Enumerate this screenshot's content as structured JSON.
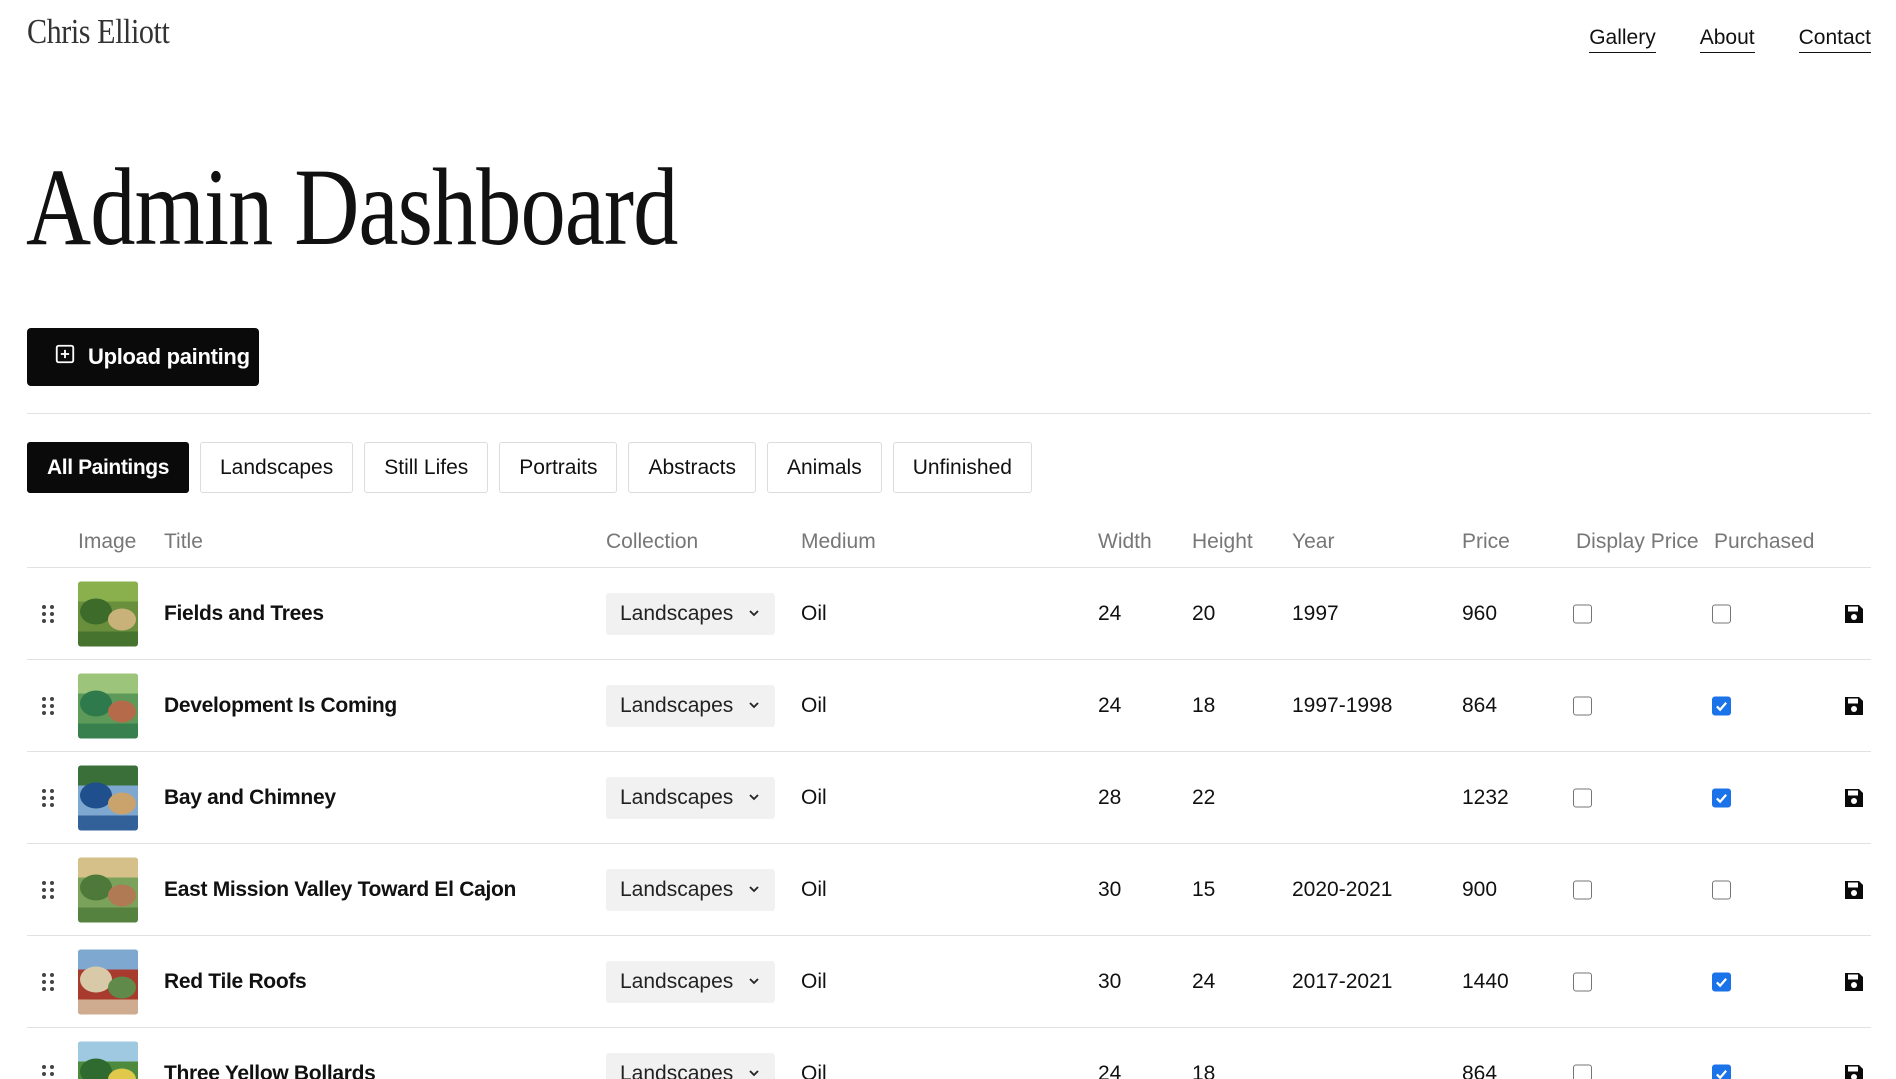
{
  "header": {
    "brand": "Chris Elliott",
    "nav": [
      {
        "label": "Gallery"
      },
      {
        "label": "About"
      },
      {
        "label": "Contact"
      }
    ]
  },
  "page_title": "Admin Dashboard",
  "upload_button_label": "Upload painting",
  "filters": [
    {
      "label": "All Paintings",
      "active": true
    },
    {
      "label": "Landscapes"
    },
    {
      "label": "Still Lifes"
    },
    {
      "label": "Portraits"
    },
    {
      "label": "Abstracts"
    },
    {
      "label": "Animals"
    },
    {
      "label": "Unfinished"
    }
  ],
  "table": {
    "headers": {
      "image": "Image",
      "title": "Title",
      "collection": "Collection",
      "medium": "Medium",
      "width": "Width",
      "height": "Height",
      "year": "Year",
      "price": "Price",
      "display_price": "Display Price",
      "purchased": "Purchased"
    },
    "rows": [
      {
        "title": "Fields and Trees",
        "collection": "Landscapes",
        "medium": "Oil",
        "width": "24",
        "height": "20",
        "year": "1997",
        "price": "960",
        "display_price": false,
        "purchased": false
      },
      {
        "title": "Development Is Coming",
        "collection": "Landscapes",
        "medium": "Oil",
        "width": "24",
        "height": "18",
        "year": "1997-1998",
        "price": "864",
        "display_price": false,
        "purchased": true
      },
      {
        "title": "Bay and Chimney",
        "collection": "Landscapes",
        "medium": "Oil",
        "width": "28",
        "height": "22",
        "year": "",
        "price": "1232",
        "display_price": false,
        "purchased": true
      },
      {
        "title": "East Mission Valley Toward El Cajon",
        "collection": "Landscapes",
        "medium": "Oil",
        "width": "30",
        "height": "15",
        "year": "2020-2021",
        "price": "900",
        "display_price": false,
        "purchased": false
      },
      {
        "title": "Red Tile Roofs",
        "collection": "Landscapes",
        "medium": "Oil",
        "width": "30",
        "height": "24",
        "year": "2017-2021",
        "price": "1440",
        "display_price": false,
        "purchased": true
      },
      {
        "title": "Three Yellow Bollards",
        "collection": "Landscapes",
        "medium": "Oil",
        "width": "24",
        "height": "18",
        "year": "",
        "price": "864",
        "display_price": false,
        "purchased": true
      }
    ]
  },
  "icons": {
    "upload": "plus-square-icon",
    "drag": "drag-handle-icon",
    "select": "chevron-down-icon",
    "save": "floppy-disk-icon",
    "check": "checkmark-icon"
  },
  "colors": {
    "primary": "#0a0a0a",
    "checkbox_checked": "#1a73e8",
    "header_text": "#777777",
    "divider": "#e2e2e2"
  }
}
